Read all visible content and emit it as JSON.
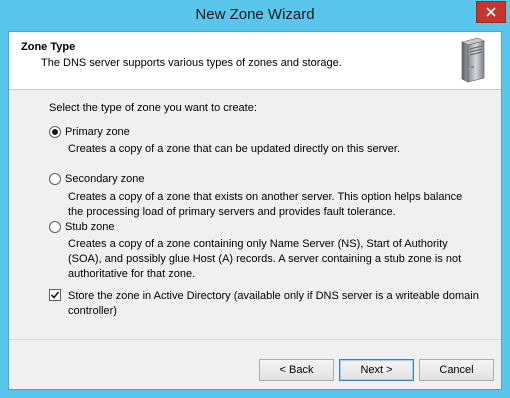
{
  "window": {
    "title": "New Zone Wizard"
  },
  "header": {
    "title": "Zone Type",
    "subtitle": "The DNS server supports various types of zones and storage."
  },
  "prompt": "Select the type of zone you want to create:",
  "options": [
    {
      "label": "Primary zone",
      "selected": true,
      "description": "Creates a copy of a zone that can be updated directly on this server."
    },
    {
      "label": "Secondary zone",
      "selected": false,
      "description": "Creates a copy of a zone that exists on another server. This option helps balance the processing load of primary servers and provides fault tolerance."
    },
    {
      "label": "Stub zone",
      "selected": false,
      "description": "Creates a copy of a zone containing only Name Server (NS), Start of Authority (SOA), and possibly glue Host (A) records. A server containing a stub zone is not authoritative for that zone."
    }
  ],
  "store_ad": {
    "checked": true,
    "label": "Store the zone in Active Directory (available only if DNS server is a writeable domain controller)"
  },
  "buttons": {
    "back": "< Back",
    "next": "Next >",
    "cancel": "Cancel"
  },
  "colors": {
    "titlebar": "#5bc6ec",
    "close": "#c7352e",
    "dialog": "#f0f0f0",
    "header": "#ffffff"
  },
  "icons": {
    "close": "close-icon",
    "header": "server-icon"
  }
}
